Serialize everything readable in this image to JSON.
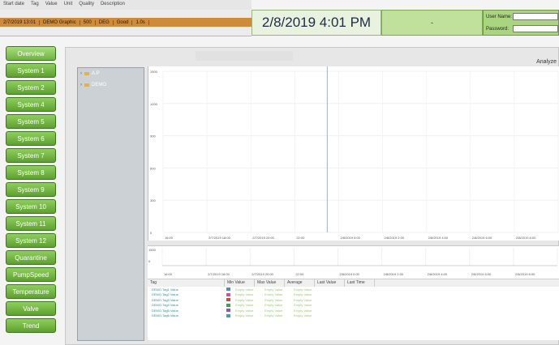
{
  "header": {
    "columns": [
      "Start date",
      "Tag",
      "Value",
      "Unit",
      "Quality",
      "Description"
    ],
    "row": [
      "2/7/2019 13:01",
      "DEMO Graphic",
      "500",
      "DEG",
      "Good",
      "1.0s"
    ],
    "datetime": "2/8/2019 4:01 PM",
    "dash": "-",
    "login": {
      "user_label": "User Name:",
      "pass_label": "Password:"
    }
  },
  "nav": [
    "Overview",
    "System 1",
    "System 2",
    "System 4",
    "System 5",
    "System 6",
    "System 7",
    "System 8",
    "System 9",
    "System 10",
    "System 11",
    "System 12",
    "Quarantine",
    "PumpSpeed",
    "Temperature",
    "Valve",
    "Trend"
  ],
  "nav_active": 0,
  "toolbar": {
    "analyze": "Analyze"
  },
  "tree": [
    {
      "label": "A.P"
    },
    {
      "label": "DEMO"
    }
  ],
  "chart_data": {
    "type": "line",
    "title": "",
    "ylim": [
      0,
      1500
    ],
    "yticks": [
      "1500",
      "1200",
      "900",
      "600",
      "300",
      "0"
    ],
    "xticks": [
      "16:00",
      "2/7/2019 18:00",
      "2/7/2019 20:00",
      "22:00",
      "2/8/2019 0:00",
      "2/8/2019 2:00",
      "2/8/2019 4:00",
      "2/8/2019 6:00",
      "2/8/2019 8:00",
      "2/8/2019 10:00"
    ],
    "series": [],
    "cursor_x": "2/8/2019 0:00"
  },
  "strip": {
    "labels": [
      "1500",
      "0"
    ]
  },
  "grid": {
    "headers": [
      "Tag",
      "Min Value",
      "Max Value",
      "Average",
      "Last Value",
      "Last Time"
    ],
    "rows": [
      {
        "tag": "DEMO.Tag1 Value",
        "color": "#4a8bd6",
        "vals": [
          "Empty Value",
          "Empty Value",
          "Empty Value"
        ]
      },
      {
        "tag": "DEMO.Tag2 Value",
        "color": "#d64ab5",
        "vals": [
          "Empty Value",
          "Empty Value",
          "Empty Value"
        ]
      },
      {
        "tag": "DEMO.Tag3 Value",
        "color": "#e0452e",
        "vals": [
          "Empty Value",
          "Empty Value",
          "Empty Value"
        ]
      },
      {
        "tag": "DEMO.Tag4 Value",
        "color": "#3aa64a",
        "vals": [
          "Empty Value",
          "Empty Value",
          "Empty Value"
        ]
      },
      {
        "tag": "DEMO.Tag5 Value",
        "color": "#9a4ad6",
        "vals": [
          "Empty Value",
          "Empty Value",
          "Empty Value"
        ]
      },
      {
        "tag": "DEMO.Tag6 Value",
        "color": "#3aa6a6",
        "vals": [
          "Empty Value",
          "Empty Value",
          "Empty Value"
        ]
      }
    ]
  }
}
